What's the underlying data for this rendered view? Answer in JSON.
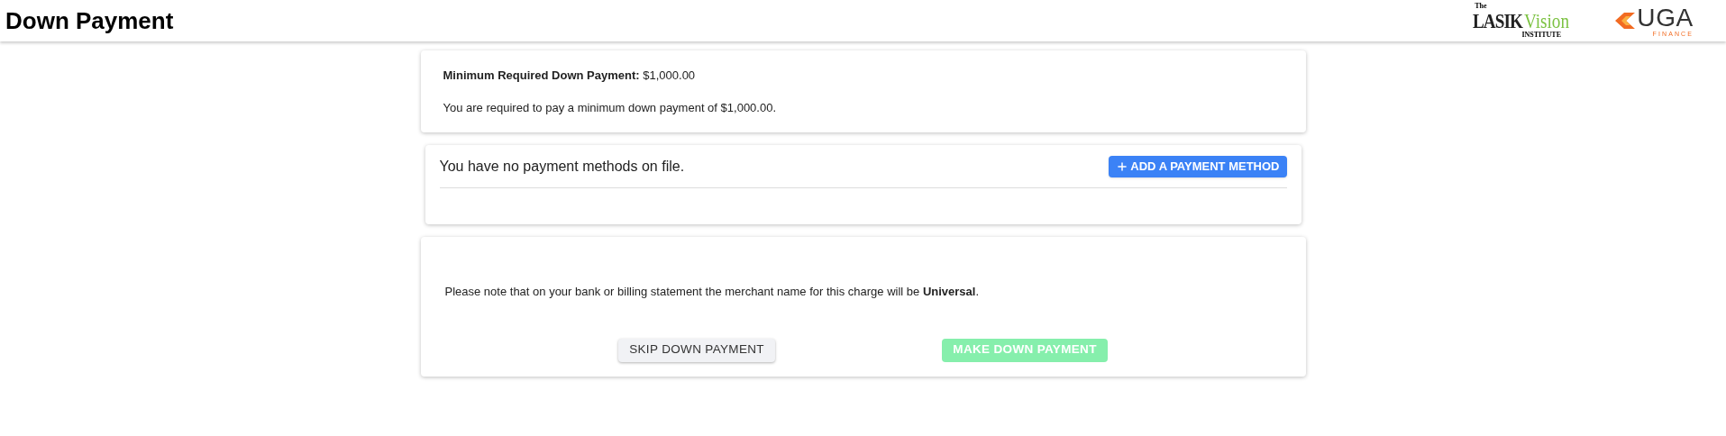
{
  "header": {
    "title": "Down Payment",
    "logos": [
      {
        "kind": "lasik",
        "small": "The",
        "main": "LASIK",
        "accent": "Vision",
        "sub": "INSTITUTE"
      },
      {
        "kind": "uga",
        "main": "UGA",
        "sub": "FINANCE"
      }
    ]
  },
  "summary": {
    "label": "Minimum Required Down Payment:",
    "amount": "$1,000.00",
    "note": "You are required to pay a minimum down payment of $1,000.00."
  },
  "payment_methods": {
    "message": "You have no payment methods on file.",
    "add_button": "ADD A PAYMENT METHOD"
  },
  "notice": {
    "text": "Please note that on your bank or billing statement the merchant name for this charge will be **Universal**.",
    "buttons": [
      {
        "label": "SKIP DOWN PAYMENT",
        "kind": "secondary",
        "disabled": false
      },
      {
        "label": "MAKE DOWN PAYMENT",
        "kind": "primary",
        "disabled": true
      }
    ]
  }
}
